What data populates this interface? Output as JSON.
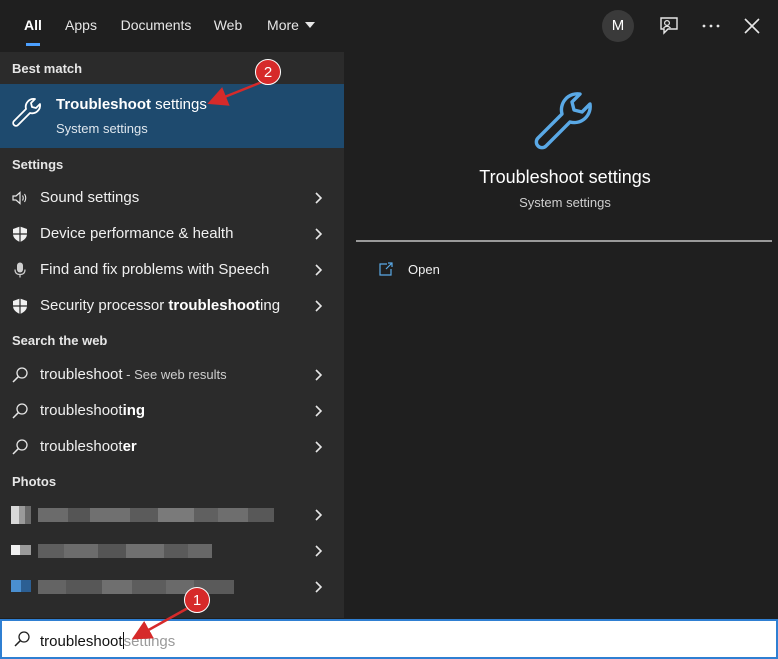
{
  "tabs": [
    {
      "label": "All"
    },
    {
      "label": "Apps"
    },
    {
      "label": "Documents"
    },
    {
      "label": "Web"
    },
    {
      "label": "More"
    }
  ],
  "user": {
    "initial": "M"
  },
  "best_match": {
    "heading": "Best match",
    "title_bold": "Troubleshoot",
    "title_rest": " settings",
    "subtitle": "System settings"
  },
  "settings": {
    "heading": "Settings",
    "items": [
      {
        "pre": "Sound settings",
        "bold": "",
        "post": ""
      },
      {
        "pre": "Device performance & health",
        "bold": "",
        "post": ""
      },
      {
        "pre": "Find and fix problems with Speech",
        "bold": "",
        "post": ""
      },
      {
        "pre": "Security processor ",
        "bold": "troubleshoot",
        "post": "ing"
      }
    ]
  },
  "web": {
    "heading": "Search the web",
    "items": [
      {
        "pre": "troubleshoot",
        "bold": "",
        "post": "",
        "small": " - See web results"
      },
      {
        "pre": "troubleshoot",
        "bold": "ing",
        "post": "",
        "small": ""
      },
      {
        "pre": "troubleshoot",
        "bold": "er",
        "post": "",
        "small": ""
      }
    ]
  },
  "photos": {
    "heading": "Photos"
  },
  "preview": {
    "title": "Troubleshoot settings",
    "subtitle": "System settings",
    "open_label": "Open"
  },
  "search": {
    "typed": "troubleshoot",
    "suggestion": "settings"
  },
  "annotations": [
    {
      "number": "1"
    },
    {
      "number": "2"
    }
  ],
  "colors": {
    "accent": "#4ca0ff",
    "selected_bg": "#1e4a6e",
    "annotation_red": "#d62a2a",
    "icon_blue": "#5aa9e6"
  }
}
